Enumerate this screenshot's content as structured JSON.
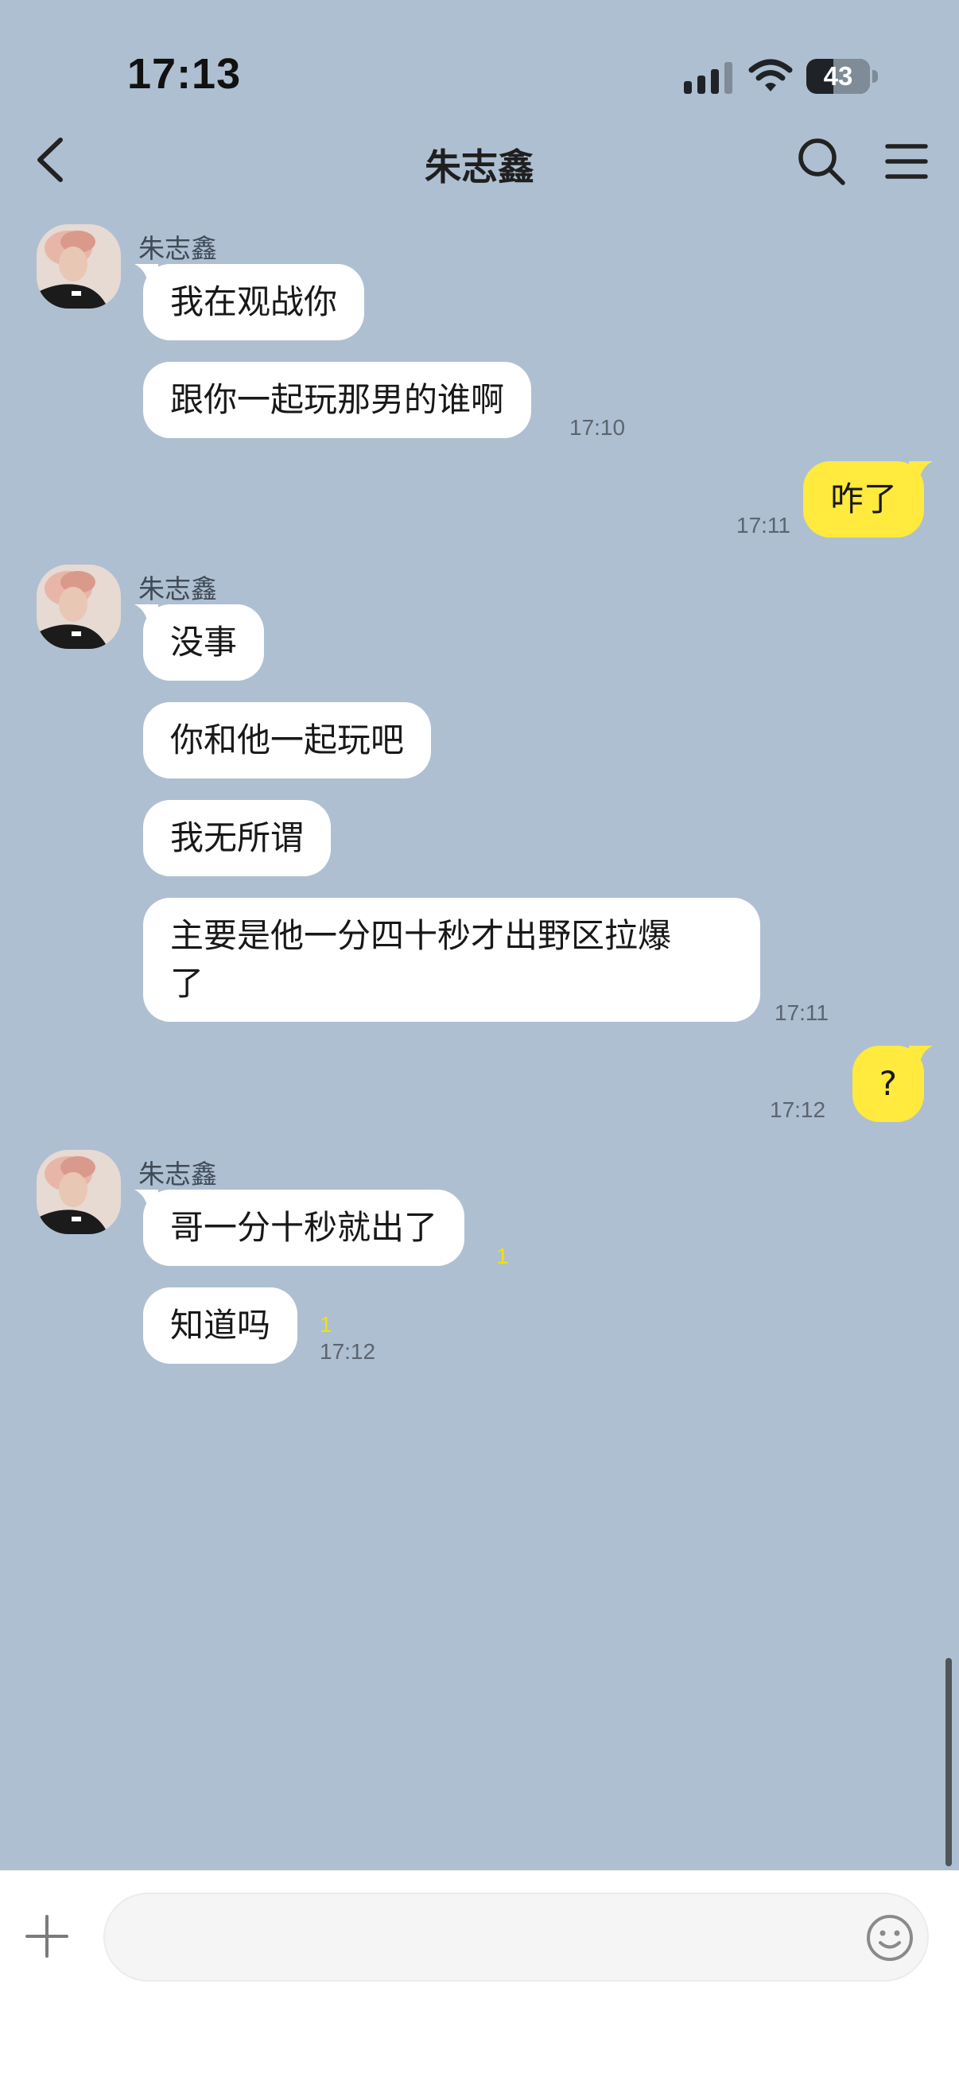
{
  "status_bar": {
    "time": "17:13",
    "battery": "43",
    "battery_level_percent": 43,
    "icons": [
      "signal-icon",
      "wifi-icon",
      "battery-icon"
    ]
  },
  "header": {
    "title": "朱志鑫",
    "icons": [
      "back-arrow-icon",
      "search-icon",
      "menu-icon"
    ]
  },
  "colors": {
    "chat_background": "#aebfd1",
    "incoming_bubble": "#ffffff",
    "outgoing_bubble": "#ffea3d",
    "read_count": "#f0e300"
  },
  "contact": {
    "name": "朱志鑫"
  },
  "messages": [
    {
      "direction": "in",
      "text": "我在观战你",
      "time": ""
    },
    {
      "direction": "in",
      "text": "跟你一起玩那男的谁啊",
      "time": "17:10"
    },
    {
      "direction": "out",
      "text": "咋了",
      "time": "17:11"
    },
    {
      "direction": "in",
      "text": "没事",
      "time": ""
    },
    {
      "direction": "in",
      "text": "你和他一起玩吧",
      "time": ""
    },
    {
      "direction": "in",
      "text": "我无所谓",
      "time": ""
    },
    {
      "direction": "in",
      "text": "主要是他一分四十秒才出野区拉爆\n了",
      "time": "17:11"
    },
    {
      "direction": "out",
      "text": "?",
      "time": "17:12"
    },
    {
      "direction": "in",
      "text": "哥一分十秒就出了",
      "read": "1",
      "time": ""
    },
    {
      "direction": "in",
      "text": "知道吗",
      "read": "1",
      "time": "17:12"
    }
  ],
  "input_bar": {
    "placeholder": "",
    "icons": [
      "plus-icon",
      "emoji-icon"
    ]
  }
}
